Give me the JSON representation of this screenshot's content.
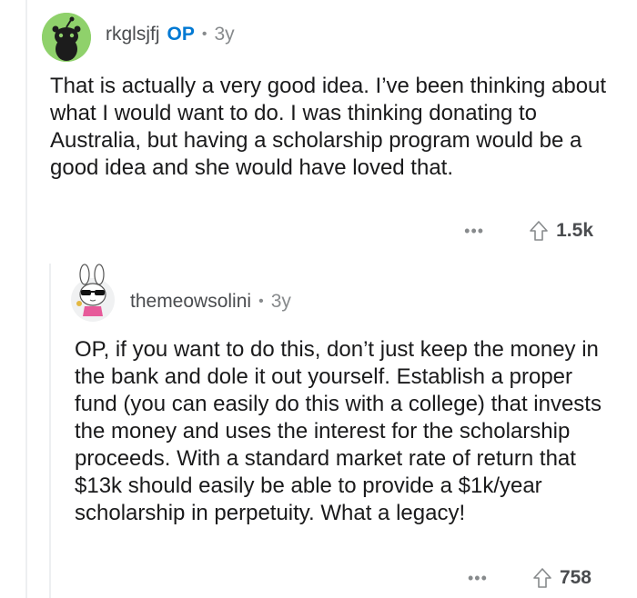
{
  "comments": [
    {
      "username": "rkglsjfj",
      "op_badge": "OP",
      "separator": "•",
      "age": "3y",
      "body": "That is actually a very good idea. I’ve been thinking about what I would want to do. I was thinking donating to Australia, but having a scholarship program would be a good idea and she would have loved that.",
      "more": "•••",
      "score": "1.5k",
      "avatar_icon": "green-snoo-avatar-icon"
    },
    {
      "username": "themeowsolini",
      "separator": "•",
      "age": "3y",
      "body": "OP, if you want to do this, don’t just keep the money in the bank and dole it out yourself. Establish a proper fund (you can easily do this with a college) that invests the money and uses the interest for the scholarship proceeds. With a standard market rate of return that $13k should easily be able to provide a $1k/year scholarship in perpetuity. What a legacy!",
      "more": "•••",
      "score": "758",
      "avatar_icon": "bunny-sunglasses-avatar-icon"
    }
  ],
  "colors": {
    "op_badge": "#0079d3",
    "avatar_green": "#8fd16b",
    "meta_gray": "#878a8c",
    "text": "#1a1a1b"
  }
}
